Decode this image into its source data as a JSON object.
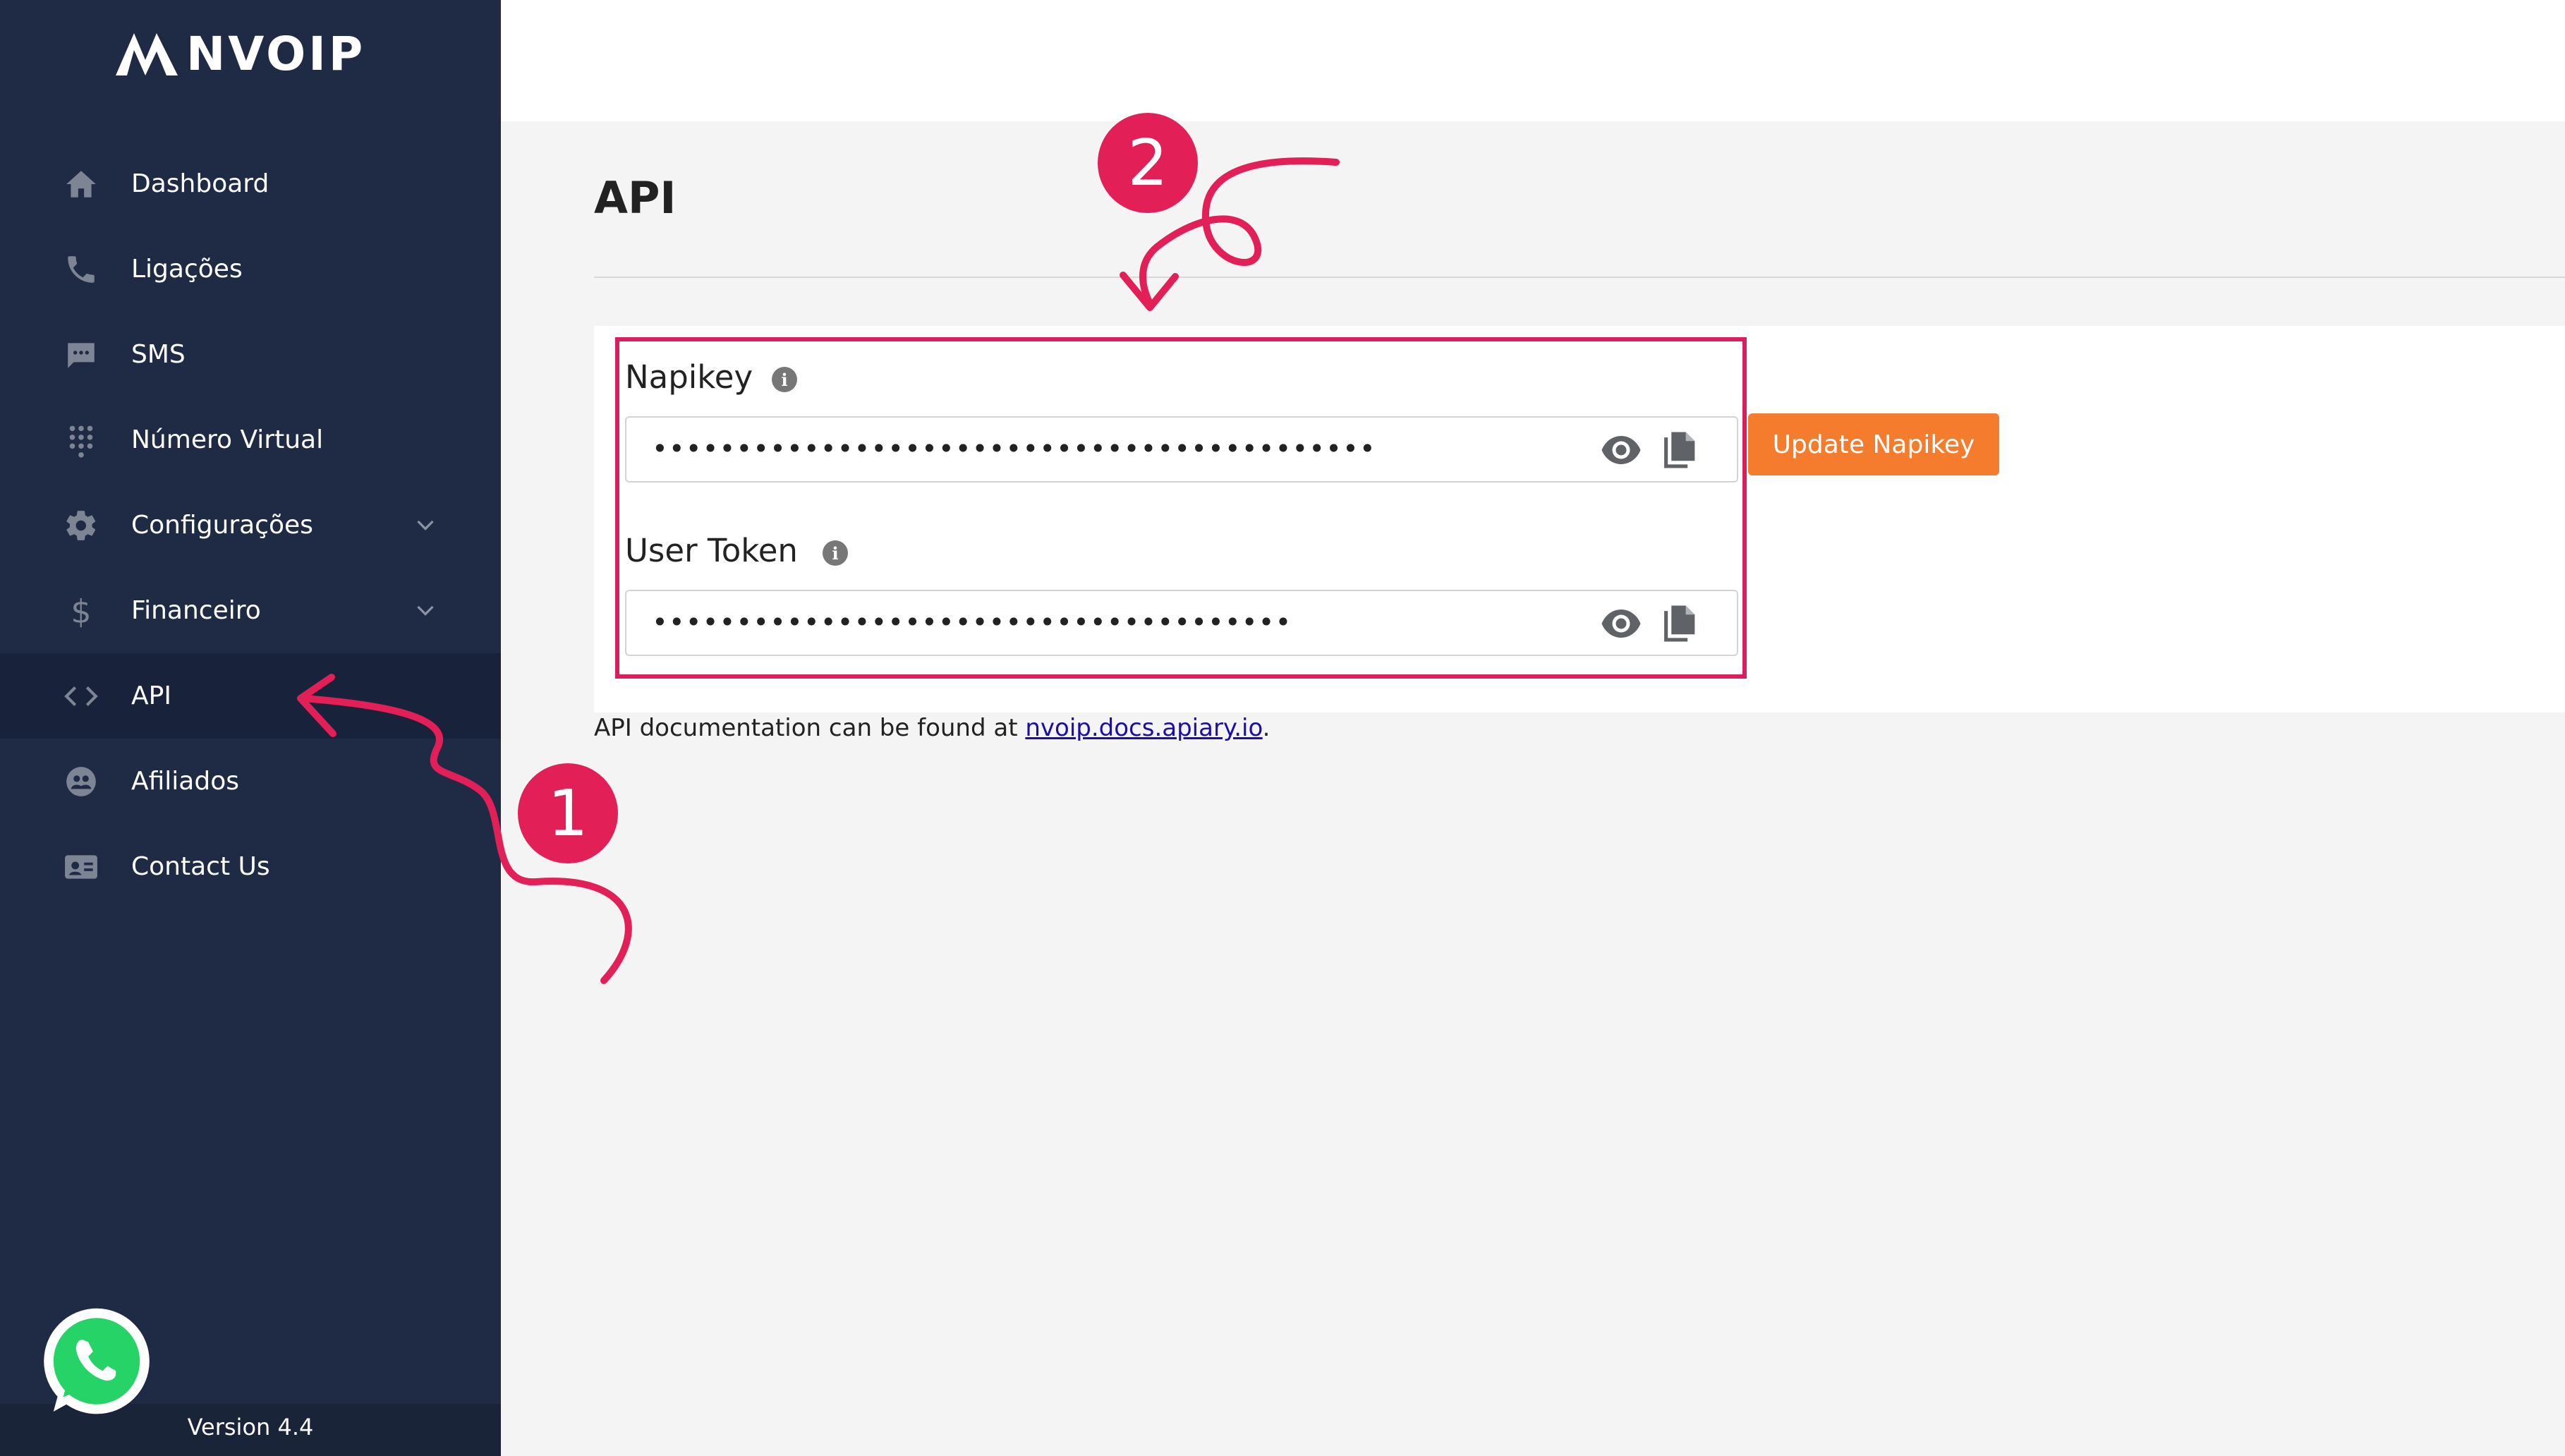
{
  "sidebar": {
    "logo_text": "NVOIP",
    "items": [
      {
        "label": "Dashboard",
        "icon": "home-icon"
      },
      {
        "label": "Ligações",
        "icon": "phone-icon"
      },
      {
        "label": "SMS",
        "icon": "chat-icon"
      },
      {
        "label": "Número Virtual",
        "icon": "dialpad-icon"
      },
      {
        "label": "Configurações",
        "icon": "gear-icon",
        "has_submenu": true
      },
      {
        "label": "Financeiro",
        "icon": "dollar-icon",
        "has_submenu": true
      },
      {
        "label": "API",
        "icon": "code-icon",
        "active": true
      },
      {
        "label": "Afiliados",
        "icon": "affiliates-icon"
      },
      {
        "label": "Contact Us",
        "icon": "contact-card-icon"
      }
    ],
    "version": "Version 4.4"
  },
  "main": {
    "title": "API",
    "napikey": {
      "label": "Napikey",
      "masked_value": "•••••••••••••••••••••••••••••••••••••••••••",
      "info_icon": "i"
    },
    "user_token": {
      "label": "User Token",
      "masked_value": "••••••••••••••••••••••••••••••••••••••",
      "info_icon": "i"
    },
    "update_button": "Update Napikey",
    "doc_prefix": "API documentation can be found at ",
    "doc_link": "nvoip.docs.apiary.io",
    "doc_suffix": "."
  },
  "annotations": {
    "badge_1": "1",
    "badge_2": "2",
    "color": "#e21f57"
  },
  "colors": {
    "sidebar_bg": "#1f2a44",
    "accent_orange": "#f47c2c",
    "highlight": "#d91e5b"
  }
}
